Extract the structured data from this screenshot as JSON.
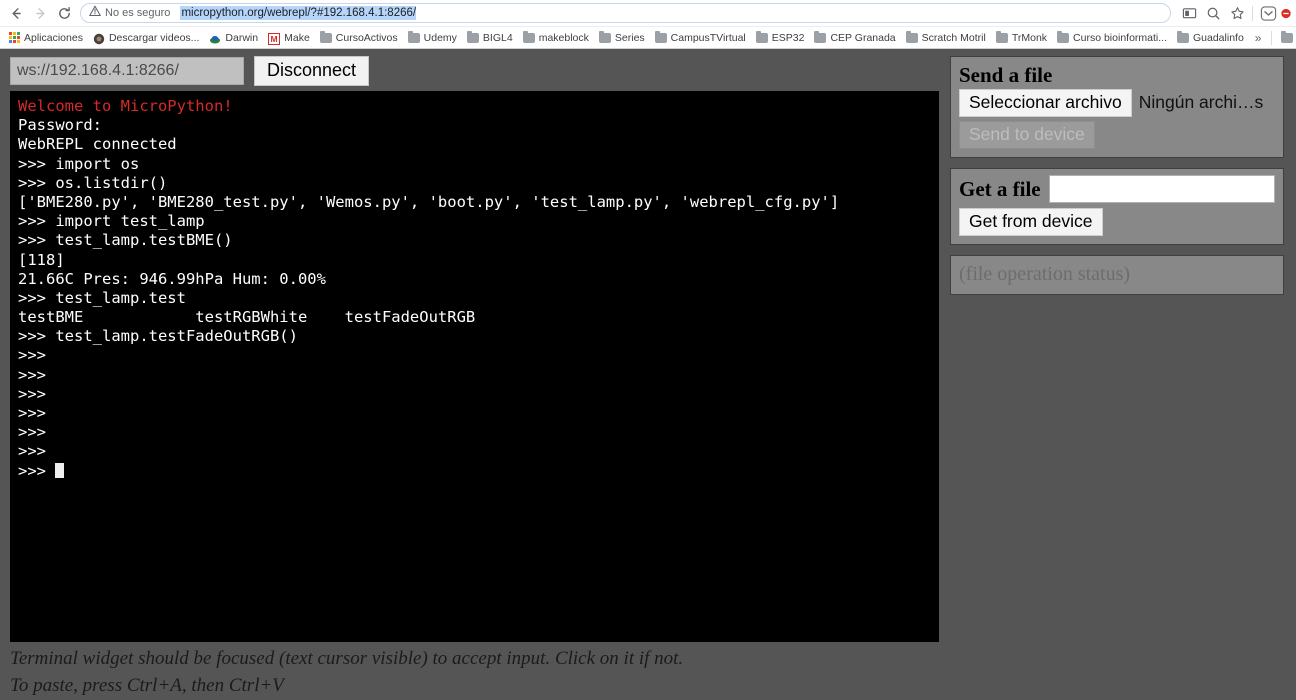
{
  "browser": {
    "back_icon": "back-arrow-icon",
    "forward_icon": "forward-arrow-icon",
    "reload_icon": "reload-icon",
    "security_label": "No es seguro",
    "url": "micropython.org/webrepl/?#192.168.4.1:8266/",
    "toolbar_icons": [
      "cast-icon",
      "zoom-search-icon",
      "bookmark-star-icon",
      "pocket-extension-icon",
      "adblock-extension-icon"
    ],
    "accent_selection": "#b5d5fb",
    "bookmarks": [
      {
        "label": "Aplicaciones",
        "icon": "apps-grid-icon"
      },
      {
        "label": "Descargar videos...",
        "icon": "video-download-icon"
      },
      {
        "label": "Darwin",
        "icon": "darwin-icon"
      },
      {
        "label": "Make",
        "icon": "make-icon"
      },
      {
        "label": "CursoActivos",
        "icon": "folder-icon"
      },
      {
        "label": "Udemy",
        "icon": "folder-icon"
      },
      {
        "label": "BIGL4",
        "icon": "folder-icon"
      },
      {
        "label": "makeblock",
        "icon": "folder-icon"
      },
      {
        "label": "Series",
        "icon": "folder-icon"
      },
      {
        "label": "CampusTVirtual",
        "icon": "folder-icon"
      },
      {
        "label": "ESP32",
        "icon": "folder-icon"
      },
      {
        "label": "CEP Granada",
        "icon": "folder-icon"
      },
      {
        "label": "Scratch Motril",
        "icon": "folder-icon"
      },
      {
        "label": "TrMonk",
        "icon": "folder-icon"
      },
      {
        "label": "Curso bioinformati...",
        "icon": "folder-icon"
      },
      {
        "label": "Guadalinfo",
        "icon": "folder-icon"
      }
    ],
    "overflow_label": "»"
  },
  "webrepl": {
    "connection": {
      "url_value": "ws://192.168.4.1:8266/",
      "url_placeholder": "ws://192.168.4.1:8266/",
      "disconnect_label": "Disconnect"
    },
    "terminal": {
      "lines": [
        {
          "text": "Welcome to MicroPython!",
          "color": "red"
        },
        {
          "text": "Password:",
          "color": "white"
        },
        {
          "text": "WebREPL connected",
          "color": "white"
        },
        {
          "text": ">>> import os",
          "color": "white"
        },
        {
          "text": ">>> os.listdir()",
          "color": "white"
        },
        {
          "text": "['BME280.py', 'BME280_test.py', 'Wemos.py', 'boot.py', 'test_lamp.py', 'webrepl_cfg.py']",
          "color": "white"
        },
        {
          "text": ">>> import test_lamp",
          "color": "white"
        },
        {
          "text": ">>> test_lamp.testBME()",
          "color": "white"
        },
        {
          "text": "[118]",
          "color": "white"
        },
        {
          "text": "21.66C Pres: 946.99hPa Hum: 0.00%",
          "color": "white"
        },
        {
          "text": ">>> test_lamp.test",
          "color": "white"
        },
        {
          "text": "testBME            testRGBWhite    testFadeOutRGB",
          "color": "white"
        },
        {
          "text": ">>> test_lamp.testFadeOutRGB()",
          "color": "white"
        },
        {
          "text": ">>>",
          "color": "white"
        },
        {
          "text": ">>>",
          "color": "white"
        },
        {
          "text": ">>>",
          "color": "white"
        },
        {
          "text": ">>>",
          "color": "white"
        },
        {
          "text": ">>>",
          "color": "white"
        },
        {
          "text": ">>>",
          "color": "white"
        },
        {
          "text": ">>> ",
          "color": "white",
          "cursor": true
        }
      ],
      "background": "#000000",
      "prompt_color": "#ffffff",
      "welcome_color": "#d42a2a"
    },
    "hints": [
      "Terminal widget should be focused (text cursor visible) to accept input. Click on it if not.",
      "To paste, press Ctrl+A, then Ctrl+V"
    ],
    "send_panel": {
      "title": "Send a file",
      "choose_file_label": "Seleccionar archivo",
      "chosen_file_label": "Ningún archi…s",
      "send_button_label": "Send to device",
      "send_button_disabled": true
    },
    "get_panel": {
      "title": "Get a file",
      "filename_value": "",
      "filename_placeholder": "",
      "get_button_label": "Get from device"
    },
    "status_panel": {
      "text": "(file operation status)"
    }
  }
}
